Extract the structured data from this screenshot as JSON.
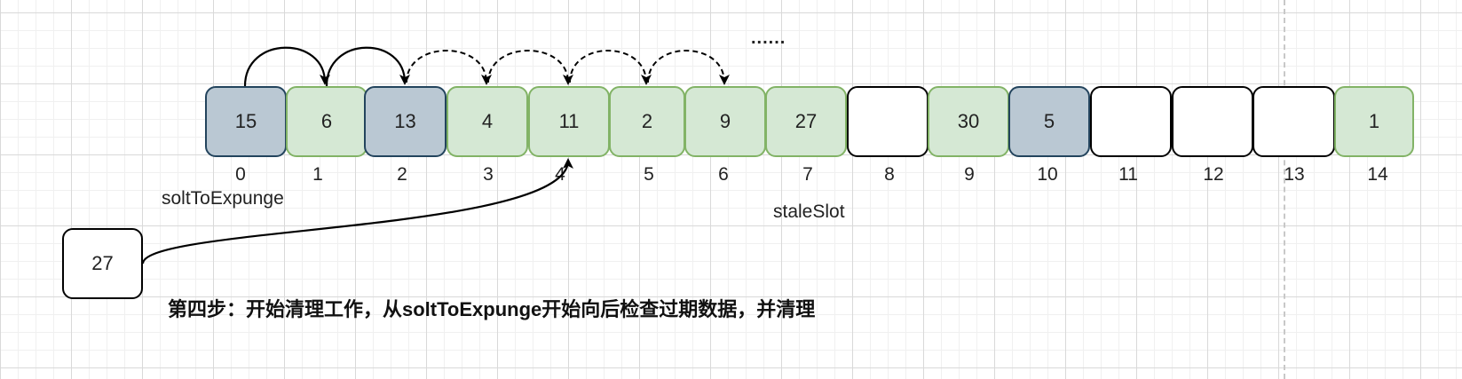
{
  "cells": [
    {
      "index": "0",
      "value": "15",
      "style": "blue"
    },
    {
      "index": "1",
      "value": "6",
      "style": "green"
    },
    {
      "index": "2",
      "value": "13",
      "style": "blue"
    },
    {
      "index": "3",
      "value": "4",
      "style": "green"
    },
    {
      "index": "4",
      "value": "11",
      "style": "green"
    },
    {
      "index": "5",
      "value": "2",
      "style": "green"
    },
    {
      "index": "6",
      "value": "9",
      "style": "green"
    },
    {
      "index": "7",
      "value": "27",
      "style": "green"
    },
    {
      "index": "8",
      "value": "",
      "style": "empty"
    },
    {
      "index": "9",
      "value": "30",
      "style": "green"
    },
    {
      "index": "10",
      "value": "5",
      "style": "blue"
    },
    {
      "index": "11",
      "value": "",
      "style": "empty"
    },
    {
      "index": "12",
      "value": "",
      "style": "empty"
    },
    {
      "index": "13",
      "value": "",
      "style": "empty"
    },
    {
      "index": "14",
      "value": "1",
      "style": "green"
    }
  ],
  "labels": {
    "solt_to_expunge": "soltToExpunge",
    "stale_slot": "staleSlot",
    "ellipsis": "......"
  },
  "new_entry": {
    "value": "27"
  },
  "caption": "第四步：开始清理工作，从soltToExpunge开始向后检查过期数据，并清理",
  "colors": {
    "green_fill": "#d5e8d4",
    "green_stroke": "#82b366",
    "blue_fill": "#bac8d3",
    "blue_stroke": "#23445d",
    "empty_fill": "#ffffff"
  }
}
